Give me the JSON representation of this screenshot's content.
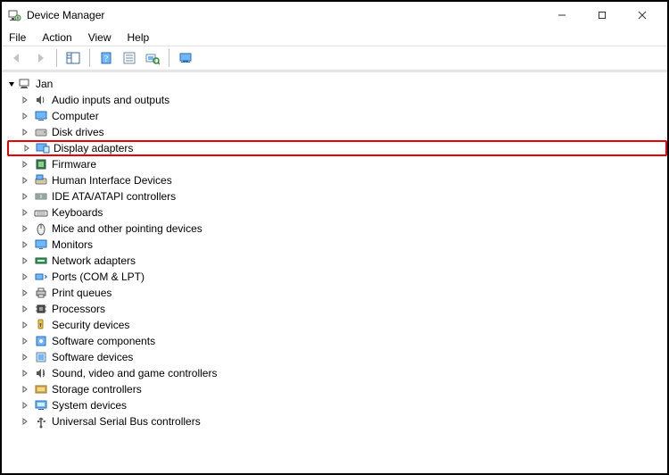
{
  "window": {
    "title": "Device Manager"
  },
  "menus": {
    "file": "File",
    "action": "Action",
    "view": "View",
    "help": "Help"
  },
  "tree": {
    "root": "Jan",
    "items": [
      {
        "label": "Audio inputs and outputs"
      },
      {
        "label": "Computer"
      },
      {
        "label": "Disk drives"
      },
      {
        "label": "Display adapters"
      },
      {
        "label": "Firmware"
      },
      {
        "label": "Human Interface Devices"
      },
      {
        "label": "IDE ATA/ATAPI controllers"
      },
      {
        "label": "Keyboards"
      },
      {
        "label": "Mice and other pointing devices"
      },
      {
        "label": "Monitors"
      },
      {
        "label": "Network adapters"
      },
      {
        "label": "Ports (COM & LPT)"
      },
      {
        "label": "Print queues"
      },
      {
        "label": "Processors"
      },
      {
        "label": "Security devices"
      },
      {
        "label": "Software components"
      },
      {
        "label": "Software devices"
      },
      {
        "label": "Sound, video and game controllers"
      },
      {
        "label": "Storage controllers"
      },
      {
        "label": "System devices"
      },
      {
        "label": "Universal Serial Bus controllers"
      }
    ],
    "highlight_index": 3
  }
}
